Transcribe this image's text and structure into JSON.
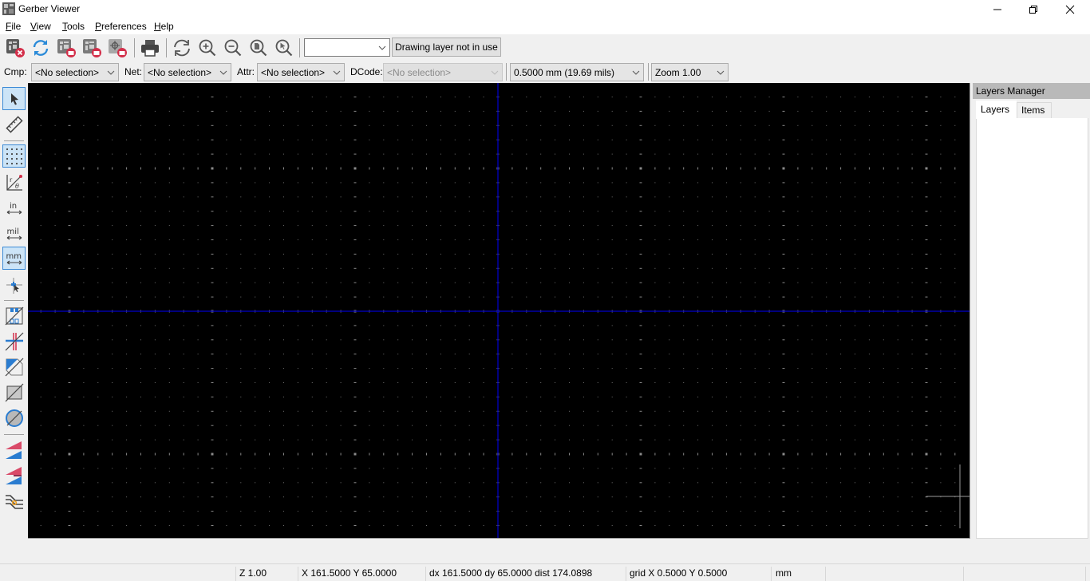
{
  "window": {
    "title": "Gerber Viewer",
    "controls": [
      "minimize",
      "restore",
      "close"
    ]
  },
  "menu": [
    {
      "label": "File",
      "mnemonic": "F",
      "rest": "ile"
    },
    {
      "label": "View",
      "mnemonic": "V",
      "rest": "iew"
    },
    {
      "label": "Tools",
      "mnemonic": "T",
      "rest": "ools"
    },
    {
      "label": "Preferences",
      "mnemonic": "P",
      "rest": "references"
    },
    {
      "label": "Help",
      "mnemonic": "H",
      "rest": "elp"
    }
  ],
  "toolbar": {
    "buttons": [
      {
        "name": "clear-layers",
        "icon": "clear-layers-icon"
      },
      {
        "name": "reload",
        "icon": "reload-icon"
      },
      {
        "name": "open-gerber",
        "icon": "open-gerber-icon"
      },
      {
        "name": "open-zip",
        "icon": "open-zip-icon"
      },
      {
        "name": "open-drill",
        "icon": "open-drill-icon"
      },
      {
        "name": "print",
        "icon": "print-icon"
      },
      {
        "name": "redraw",
        "icon": "redraw-icon"
      },
      {
        "name": "zoom-in",
        "icon": "zoom-in-icon"
      },
      {
        "name": "zoom-out",
        "icon": "zoom-out-icon"
      },
      {
        "name": "zoom-fit",
        "icon": "zoom-fit-icon"
      },
      {
        "name": "zoom-selection",
        "icon": "zoom-selection-icon"
      }
    ],
    "layer_select": {
      "value": ""
    },
    "drawing_layer_button": "Drawing layer not in use"
  },
  "filters": {
    "cmp": {
      "label": "Cmp:",
      "value": "<No selection>"
    },
    "net": {
      "label": "Net:",
      "value": "<No selection>"
    },
    "attr": {
      "label": "Attr:",
      "value": "<No selection>"
    },
    "dcode": {
      "label": "DCode:",
      "value": "<No selection>",
      "disabled": true
    },
    "grid": {
      "value": "0.5000 mm (19.69 mils)"
    },
    "zoom": {
      "value": "Zoom 1.00"
    }
  },
  "left_toolbar": [
    {
      "name": "select-tool",
      "icon": "cursor-arrow-icon",
      "active": true
    },
    {
      "name": "measure-tool",
      "icon": "ruler-icon",
      "active": false
    },
    {
      "name": "grid-toggle",
      "icon": "grid-dots-icon",
      "active": true
    },
    {
      "name": "polar-coords",
      "icon": "polar-coords-icon",
      "active": false
    },
    {
      "name": "units-inches",
      "icon": "inch-units-icon",
      "label": "in",
      "active": false
    },
    {
      "name": "units-mils",
      "icon": "mil-units-icon",
      "label": "mil",
      "active": false
    },
    {
      "name": "units-mm",
      "icon": "mm-units-icon",
      "label": "mm",
      "active": true
    },
    {
      "name": "full-crosshair",
      "icon": "crosshair-cursor-icon",
      "active": false
    },
    {
      "name": "show-flashed-sketch",
      "icon": "flashed-sketch-icon",
      "active": false
    },
    {
      "name": "show-lines-sketch",
      "icon": "lines-sketch-icon",
      "active": false
    },
    {
      "name": "show-polygons-sketch",
      "icon": "polygon-sketch-icon",
      "active": false
    },
    {
      "name": "show-negative-objects",
      "icon": "negative-objects-icon",
      "active": false
    },
    {
      "name": "show-dcodes",
      "icon": "dcodes-icon",
      "active": false
    },
    {
      "name": "diff-mode",
      "icon": "layers-diff-icon",
      "active": false
    },
    {
      "name": "high-contrast-mode",
      "icon": "layers-contrast-icon",
      "active": false
    },
    {
      "name": "show-nets",
      "icon": "net-highlight-icon",
      "active": false
    }
  ],
  "colors": {
    "canvas_bg": "#000000",
    "axis": "#0000a8",
    "grid_dot": "#6e6e6e",
    "cursor": "#9b9b9b",
    "active_button": "#cce4f7",
    "active_border": "#3c8ad6"
  },
  "layers_manager": {
    "title": "Layers Manager",
    "tabs": [
      {
        "label": "Layers",
        "active": true
      },
      {
        "label": "Items",
        "active": false
      }
    ]
  },
  "status": {
    "zoom": "Z 1.00",
    "position": "X 161.5000  Y 65.0000",
    "delta": "dx 161.5000  dy 65.0000  dist 174.0898",
    "grid": "grid X 0.5000  Y 0.5000",
    "units": "mm",
    "extra1": "",
    "extra2": ""
  }
}
